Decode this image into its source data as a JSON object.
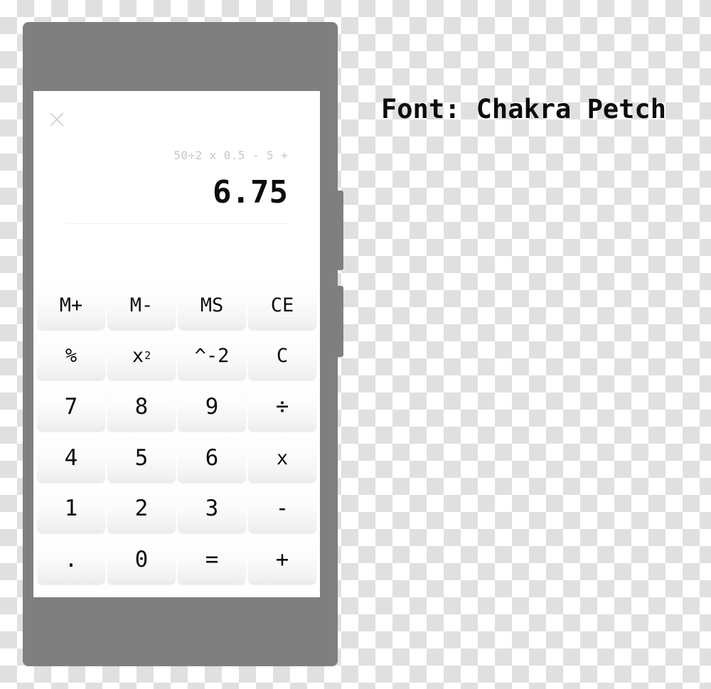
{
  "caption": {
    "font_label": "Font: Chakra Petch"
  },
  "device": {
    "frame_color": "#7f7f7f",
    "screen_color": "#ffffff",
    "side_buttons": [
      {
        "name": "volume-rocker"
      },
      {
        "name": "power-button"
      }
    ]
  },
  "app": {
    "close_icon": "close-icon",
    "display": {
      "expression": "50÷2 x 0.5 - 5 +",
      "result": "6.75",
      "expression_color": "#c6c6c6",
      "result_color": "#0d0d0d"
    },
    "keypad": {
      "rows": [
        [
          {
            "label": "M+",
            "name": "key-memory-add",
            "size": "small"
          },
          {
            "label": "M-",
            "name": "key-memory-subtract",
            "size": "small"
          },
          {
            "label": "MS",
            "name": "key-memory-store",
            "size": "small"
          },
          {
            "label": "CE",
            "name": "key-clear-entry",
            "size": "small"
          }
        ],
        [
          {
            "label": "%",
            "name": "key-percent",
            "size": "small"
          },
          {
            "label": "x",
            "sup": "2",
            "name": "key-square",
            "size": "small"
          },
          {
            "label": "^-2",
            "name": "key-power-negative-two",
            "size": "small"
          },
          {
            "label": "C",
            "name": "key-clear",
            "size": "small"
          }
        ],
        [
          {
            "label": "7",
            "name": "key-7",
            "size": "normal"
          },
          {
            "label": "8",
            "name": "key-8",
            "size": "normal"
          },
          {
            "label": "9",
            "name": "key-9",
            "size": "normal"
          },
          {
            "label": "÷",
            "name": "key-divide",
            "size": "normal"
          }
        ],
        [
          {
            "label": "4",
            "name": "key-4",
            "size": "normal"
          },
          {
            "label": "5",
            "name": "key-5",
            "size": "normal"
          },
          {
            "label": "6",
            "name": "key-6",
            "size": "normal"
          },
          {
            "label": "x",
            "name": "key-multiply",
            "size": "small"
          }
        ],
        [
          {
            "label": "1",
            "name": "key-1",
            "size": "normal"
          },
          {
            "label": "2",
            "name": "key-2",
            "size": "normal"
          },
          {
            "label": "3",
            "name": "key-3",
            "size": "normal"
          },
          {
            "label": "-",
            "name": "key-subtract",
            "size": "normal"
          }
        ],
        [
          {
            "label": ".",
            "name": "key-decimal-point",
            "size": "normal"
          },
          {
            "label": "0",
            "name": "key-0",
            "size": "normal"
          },
          {
            "label": "=",
            "name": "key-equals",
            "size": "normal"
          },
          {
            "label": "+",
            "name": "key-add",
            "size": "normal"
          }
        ]
      ]
    }
  }
}
